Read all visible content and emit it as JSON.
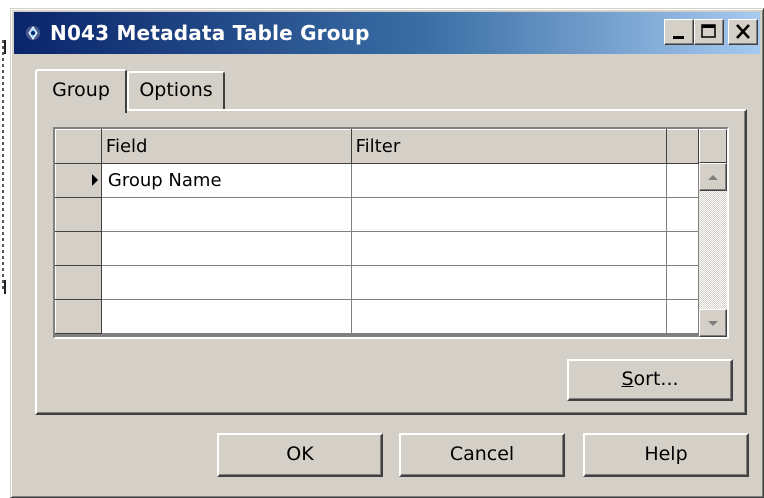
{
  "window": {
    "title": "N043 Metadata Table Group",
    "icon": "nav-diamond-icon",
    "caption_buttons": [
      "minimize",
      "maximize",
      "close"
    ],
    "title_gradient": [
      "#0a246a",
      "#a6caf0"
    ]
  },
  "tabs": [
    {
      "label": "Group",
      "active": true
    },
    {
      "label": "Options",
      "active": false
    }
  ],
  "grid": {
    "columns": [
      "Field",
      "Filter"
    ],
    "rows": [
      {
        "field": "Group Name",
        "filter": "",
        "current": true
      },
      {
        "field": "",
        "filter": "",
        "current": false
      },
      {
        "field": "",
        "filter": "",
        "current": false
      },
      {
        "field": "",
        "filter": "",
        "current": false
      },
      {
        "field": "",
        "filter": "",
        "current": false
      }
    ]
  },
  "buttons": {
    "sort": {
      "accel": "S",
      "rest": "ort..."
    },
    "ok": "OK",
    "cancel": "Cancel",
    "help": "Help"
  },
  "colors": {
    "face": "#d4d0c8",
    "highlight": "#ffffff",
    "shadow": "#808080",
    "dark_shadow": "#404040"
  }
}
